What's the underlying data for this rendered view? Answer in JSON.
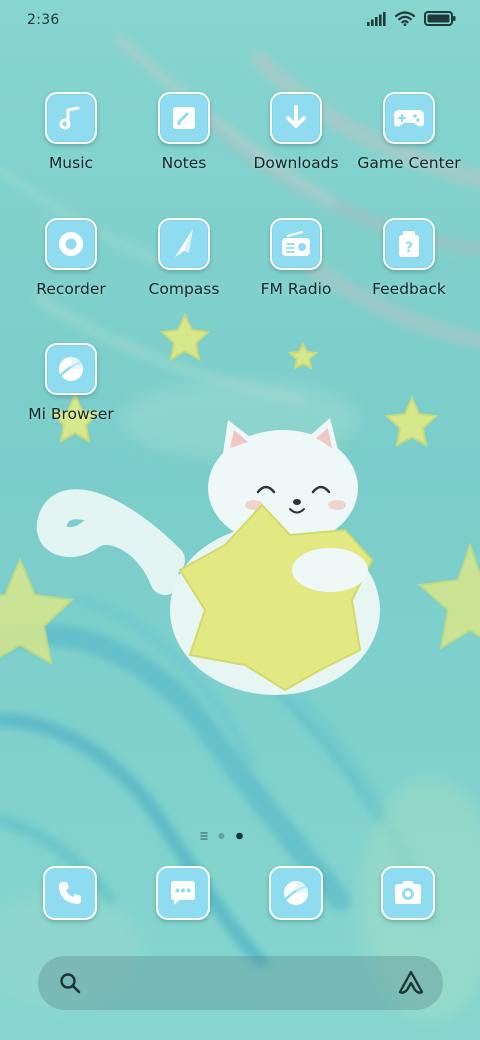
{
  "status_bar": {
    "time": "2:36",
    "icons": [
      "signal-icon",
      "wifi-icon",
      "battery-icon"
    ]
  },
  "apps": [
    {
      "label": "Music",
      "icon": "music-note-icon"
    },
    {
      "label": "Notes",
      "icon": "notes-icon"
    },
    {
      "label": "Downloads",
      "icon": "download-arrow-icon"
    },
    {
      "label": "Game Center",
      "icon": "gamepad-icon"
    },
    {
      "label": "Recorder",
      "icon": "record-icon"
    },
    {
      "label": "Compass",
      "icon": "compass-needle-icon"
    },
    {
      "label": "FM Radio",
      "icon": "radio-icon"
    },
    {
      "label": "Feedback",
      "icon": "feedback-icon"
    },
    {
      "label": "Mi Browser",
      "icon": "browser-planet-icon"
    }
  ],
  "page_indicator": {
    "pages": 2,
    "current": 2
  },
  "dock": [
    {
      "icon": "phone-icon"
    },
    {
      "icon": "messages-icon"
    },
    {
      "icon": "browser-planet-icon"
    },
    {
      "icon": "camera-icon"
    }
  ],
  "search": {
    "placeholder": ""
  },
  "colors": {
    "wallpaper": "#79cfc9",
    "tile": "#8fdcf1",
    "tile_border": "#fbfdfd",
    "star": "#dde887",
    "cat": "#e7f6f3",
    "label": "#14282a"
  }
}
